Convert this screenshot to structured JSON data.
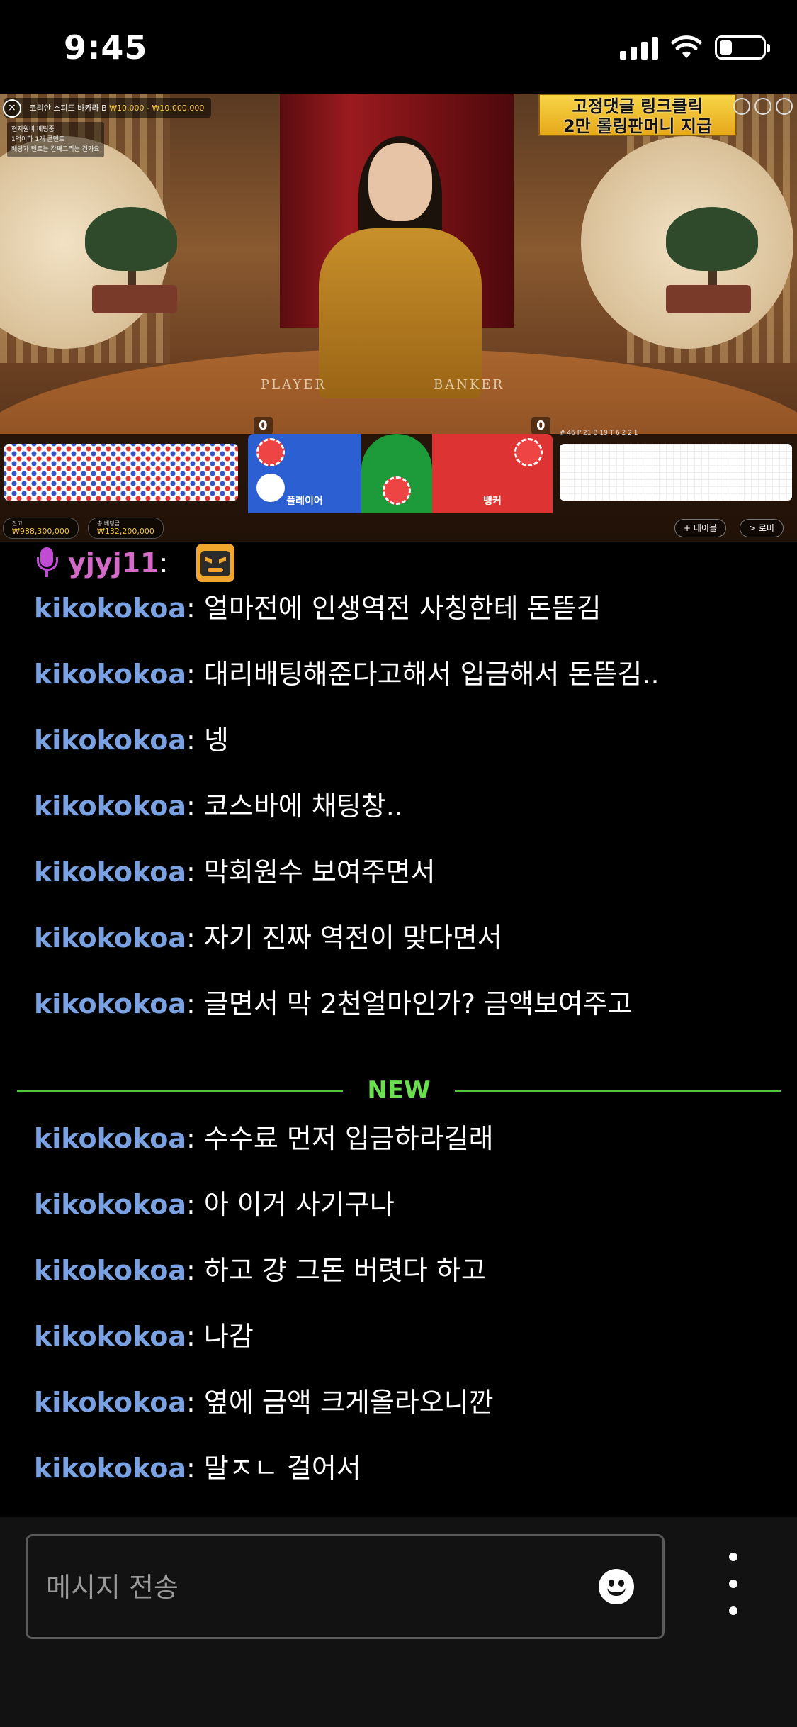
{
  "status_bar": {
    "time": "9:45",
    "icons": [
      "cellular-signal-icon",
      "wifi-icon",
      "battery-icon"
    ],
    "battery_level": 0.3
  },
  "video": {
    "table_title": "코리안 스피드 바카라 B",
    "price_range": "₩10,000 - ₩10,000,000",
    "sub_line_1": "현지원비 베팅중",
    "sub_line_2": "1억이하 1개 콘덴트",
    "sub_line_3": "배당가 텐트는 간째그리는 건가요",
    "promo_line_1": "고정댓글 링크클릭",
    "promo_line_2": "2만 롤링판머니 지급",
    "player_label": "PLAYER",
    "banker_label": "BANKER",
    "player_score": "0",
    "banker_score": "0",
    "bet_player_label": "플레이어",
    "bet_banker_label": "뱅커",
    "road_stats": "# 46  P 21  B 19  T 6  2  2  1",
    "balance_label": "잔고",
    "balance_value": "₩988,300,000",
    "total_bet_label": "총 베팅금",
    "total_bet_value": "₩132,200,000",
    "table_button": "+ 테이블",
    "lobby_button": "> 로비"
  },
  "chat": {
    "first_message": {
      "user": "yjyj11",
      "colon": ":",
      "icon": "mic-icon",
      "emote": "angry-emote-icon"
    },
    "messages_before_new": [
      {
        "user": "kikokokoa",
        "text": ": 얼마전에 인생역전 사칭한테 돈뜯김"
      },
      {
        "user": "kikokokoa",
        "text": ": 대리배팅해준다고해서 입금해서 돈뜯김.."
      },
      {
        "user": "kikokokoa",
        "text": ": 넹"
      },
      {
        "user": "kikokokoa",
        "text": ": 코스바에 채팅창.."
      },
      {
        "user": "kikokokoa",
        "text": ": 막회원수 보여주면서"
      },
      {
        "user": "kikokokoa",
        "text": ": 자기 진짜 역전이 맞다면서"
      },
      {
        "user": "kikokokoa",
        "text": ": 글면서 막 2천얼마인가? 금액보여주고"
      }
    ],
    "new_label": "NEW",
    "messages_after_new": [
      {
        "user": "kikokokoa",
        "text": ": 수수료 먼저 입금하라길래"
      },
      {
        "user": "kikokokoa",
        "text": ": 아 이거 사기구나"
      },
      {
        "user": "kikokokoa",
        "text": ": 하고 걍 그돈 버렷다 하고"
      },
      {
        "user": "kikokokoa",
        "text": ": 나감"
      },
      {
        "user": "kikokokoa",
        "text": ": 옆에 금액 크게올라오니깐"
      },
      {
        "user": "kikokokoa",
        "text": ": 말ㅈㄴ 걸어서"
      }
    ]
  },
  "input": {
    "placeholder": "메시지 전송",
    "emoji_icon": "smiley-icon",
    "more_icon": "more-vertical-icon"
  },
  "colors": {
    "username": "#7aa2e3",
    "first_user": "#d36ac8",
    "new_divider": "#4fc93a",
    "background": "#000000"
  }
}
